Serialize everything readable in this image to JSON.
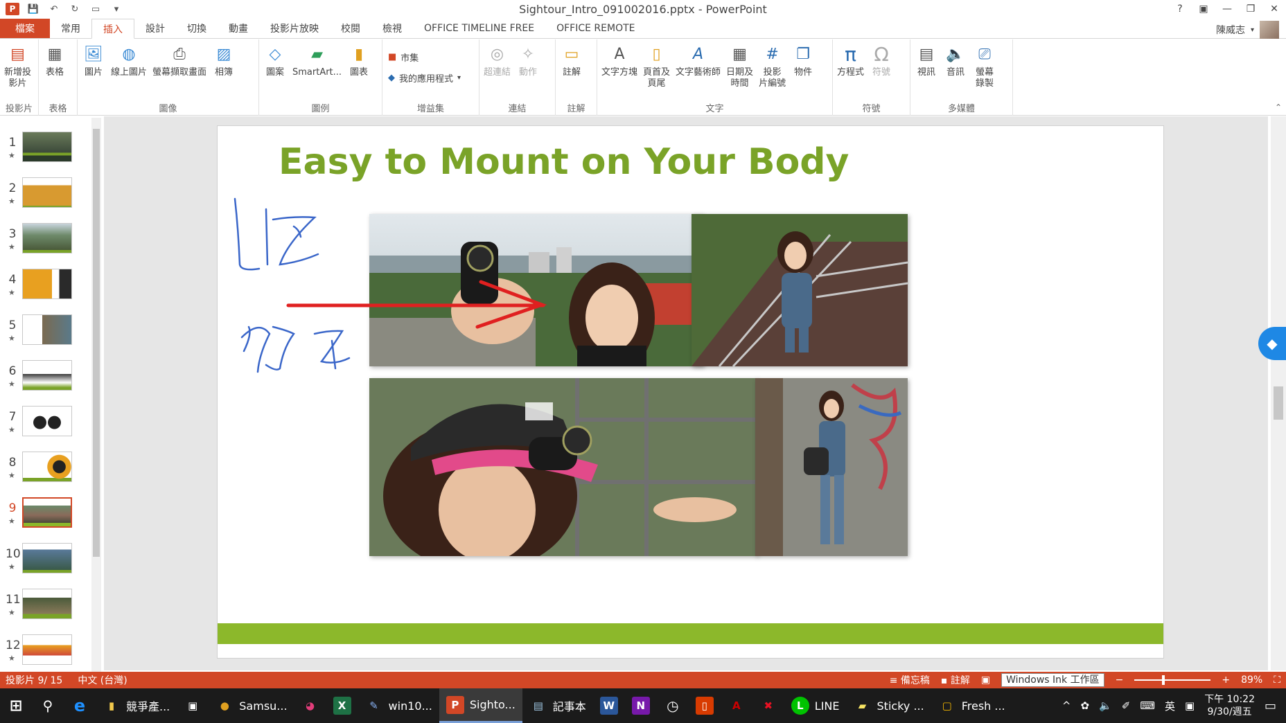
{
  "window": {
    "title": "Sightour_Intro_091002016.pptx - PowerPoint",
    "controls": [
      "?",
      "▣",
      "—",
      "❐",
      "✕"
    ]
  },
  "tabs": [
    "檔案",
    "常用",
    "插入",
    "設計",
    "切換",
    "動畫",
    "投影片放映",
    "校閱",
    "檢視",
    "OFFICE TIMELINE FREE",
    "OFFICE REMOTE"
  ],
  "active_tab": "插入",
  "user": {
    "name": "陳威志"
  },
  "ribbon": {
    "groups": [
      {
        "label": "投影片",
        "buttons": [
          {
            "label": "新增投\n影片",
            "icon": "new-slide-icon"
          }
        ]
      },
      {
        "label": "表格",
        "buttons": [
          {
            "label": "表格",
            "icon": "table-icon"
          }
        ]
      },
      {
        "label": "圖像",
        "buttons": [
          {
            "label": "圖片",
            "icon": "picture-icon"
          },
          {
            "label": "線上圖片",
            "icon": "online-picture-icon"
          },
          {
            "label": "螢幕擷取畫面",
            "icon": "screenshot-icon"
          },
          {
            "label": "相簿",
            "icon": "album-icon"
          }
        ]
      },
      {
        "label": "圖例",
        "buttons": [
          {
            "label": "圖案",
            "icon": "shapes-icon"
          },
          {
            "label": "SmartArt...",
            "icon": "smartart-icon"
          },
          {
            "label": "圖表",
            "icon": "chart-icon"
          }
        ]
      },
      {
        "label": "增益集",
        "small": [
          "市集",
          "我的應用程式"
        ]
      },
      {
        "label": "連結",
        "buttons": [
          {
            "label": "超連結",
            "icon": "hyperlink-icon",
            "disabled": true
          },
          {
            "label": "動作",
            "icon": "action-icon",
            "disabled": true
          }
        ]
      },
      {
        "label": "註解",
        "buttons": [
          {
            "label": "註解",
            "icon": "comment-icon"
          }
        ]
      },
      {
        "label": "文字",
        "buttons": [
          {
            "label": "文字方塊",
            "icon": "textbox-icon"
          },
          {
            "label": "頁首及\n頁尾",
            "icon": "header-footer-icon"
          },
          {
            "label": "文字藝術師",
            "icon": "wordart-icon"
          },
          {
            "label": "日期及\n時間",
            "icon": "date-time-icon"
          },
          {
            "label": "投影\n片編號",
            "icon": "slide-number-icon"
          },
          {
            "label": "物件",
            "icon": "object-icon"
          }
        ]
      },
      {
        "label": "符號",
        "buttons": [
          {
            "label": "方程式",
            "icon": "equation-icon"
          },
          {
            "label": "符號",
            "icon": "symbol-icon",
            "disabled": true
          }
        ]
      },
      {
        "label": "多媒體",
        "buttons": [
          {
            "label": "視訊",
            "icon": "video-icon"
          },
          {
            "label": "音訊",
            "icon": "audio-icon"
          },
          {
            "label": "螢幕\n錄製",
            "icon": "screen-recording-icon"
          }
        ]
      }
    ]
  },
  "thumbnails": [
    {
      "num": "1",
      "star": "★"
    },
    {
      "num": "2",
      "star": "★"
    },
    {
      "num": "3",
      "star": "★"
    },
    {
      "num": "4",
      "star": "★"
    },
    {
      "num": "5",
      "star": "★"
    },
    {
      "num": "6",
      "star": "★"
    },
    {
      "num": "7",
      "star": "★"
    },
    {
      "num": "8",
      "star": "★"
    },
    {
      "num": "9",
      "star": "★"
    },
    {
      "num": "10",
      "star": "★"
    },
    {
      "num": "11",
      "star": "★"
    },
    {
      "num": "12",
      "star": "★"
    }
  ],
  "selected_slide": "9",
  "slide": {
    "title": "Easy to Mount on Your Body",
    "title_color": "#7aa328",
    "bar_color": "#8cb82b",
    "ink_text": "Liz 好正",
    "ink_color": "#3a66c9",
    "arrow_color": "#e02020"
  },
  "statusbar": {
    "slide_info": "投影片 9/ 15",
    "language": "中文 (台灣)",
    "notes": "備忘稿",
    "comments": "註解",
    "ink_tooltip": "Windows Ink 工作區",
    "zoom": "89%"
  },
  "taskbar": {
    "items": [
      {
        "label": "",
        "icon": "windows-start-icon",
        "glyph": "⊞",
        "color": "#ffffff"
      },
      {
        "label": "",
        "icon": "search-icon",
        "glyph": "⚲",
        "color": "#ffffff"
      },
      {
        "label": "",
        "icon": "edge-icon",
        "glyph": "e",
        "color": "#1e90ff"
      },
      {
        "label": "競爭產...",
        "icon": "folder-icon",
        "glyph": "▮",
        "color": "#f2c94c"
      },
      {
        "label": "",
        "icon": "store-icon",
        "glyph": "▣",
        "color": "#ffffff"
      },
      {
        "label": "Samsu...",
        "icon": "chrome-icon",
        "glyph": "●",
        "color": "#e0a020"
      },
      {
        "label": "",
        "icon": "lips-icon",
        "glyph": "◕",
        "color": "#e23d7a"
      },
      {
        "label": "",
        "icon": "excel-icon",
        "glyph": "X",
        "color": "#1e7145"
      },
      {
        "label": "win10...",
        "icon": "paint-icon",
        "glyph": "✎",
        "color": "#8ab4f8"
      },
      {
        "label": "Sighto...",
        "icon": "powerpoint-icon",
        "glyph": "P",
        "color": "#d24726",
        "active": true
      },
      {
        "label": "記事本",
        "icon": "notepad-icon",
        "glyph": "▤",
        "color": "#9ec5e0"
      },
      {
        "label": "",
        "icon": "word-icon",
        "glyph": "W",
        "color": "#2b579a"
      },
      {
        "label": "",
        "icon": "onenote-icon",
        "glyph": "N",
        "color": "#7719aa"
      },
      {
        "label": "",
        "icon": "alarm-icon",
        "glyph": "◷",
        "color": "#ffffff"
      },
      {
        "label": "",
        "icon": "office-icon",
        "glyph": "▯",
        "color": "#d83b01"
      },
      {
        "label": "",
        "icon": "acrobat-icon",
        "glyph": "A",
        "color": "#cc0000"
      },
      {
        "label": "",
        "icon": "x-app-icon",
        "glyph": "✖",
        "color": "#e81123"
      },
      {
        "label": "LINE",
        "icon": "line-icon",
        "glyph": "L",
        "color": "#00c300"
      },
      {
        "label": "Sticky ...",
        "icon": "sticky-notes-icon",
        "glyph": "▰",
        "color": "#f7e463"
      },
      {
        "label": "Fresh ...",
        "icon": "fresh-icon",
        "glyph": "▢",
        "color": "#f5b800"
      }
    ],
    "tray": [
      "^",
      "✿",
      "🔈",
      "✐",
      "⌨",
      "英",
      "▣"
    ],
    "time": "下午 10:22",
    "date": "9/30/週五"
  }
}
